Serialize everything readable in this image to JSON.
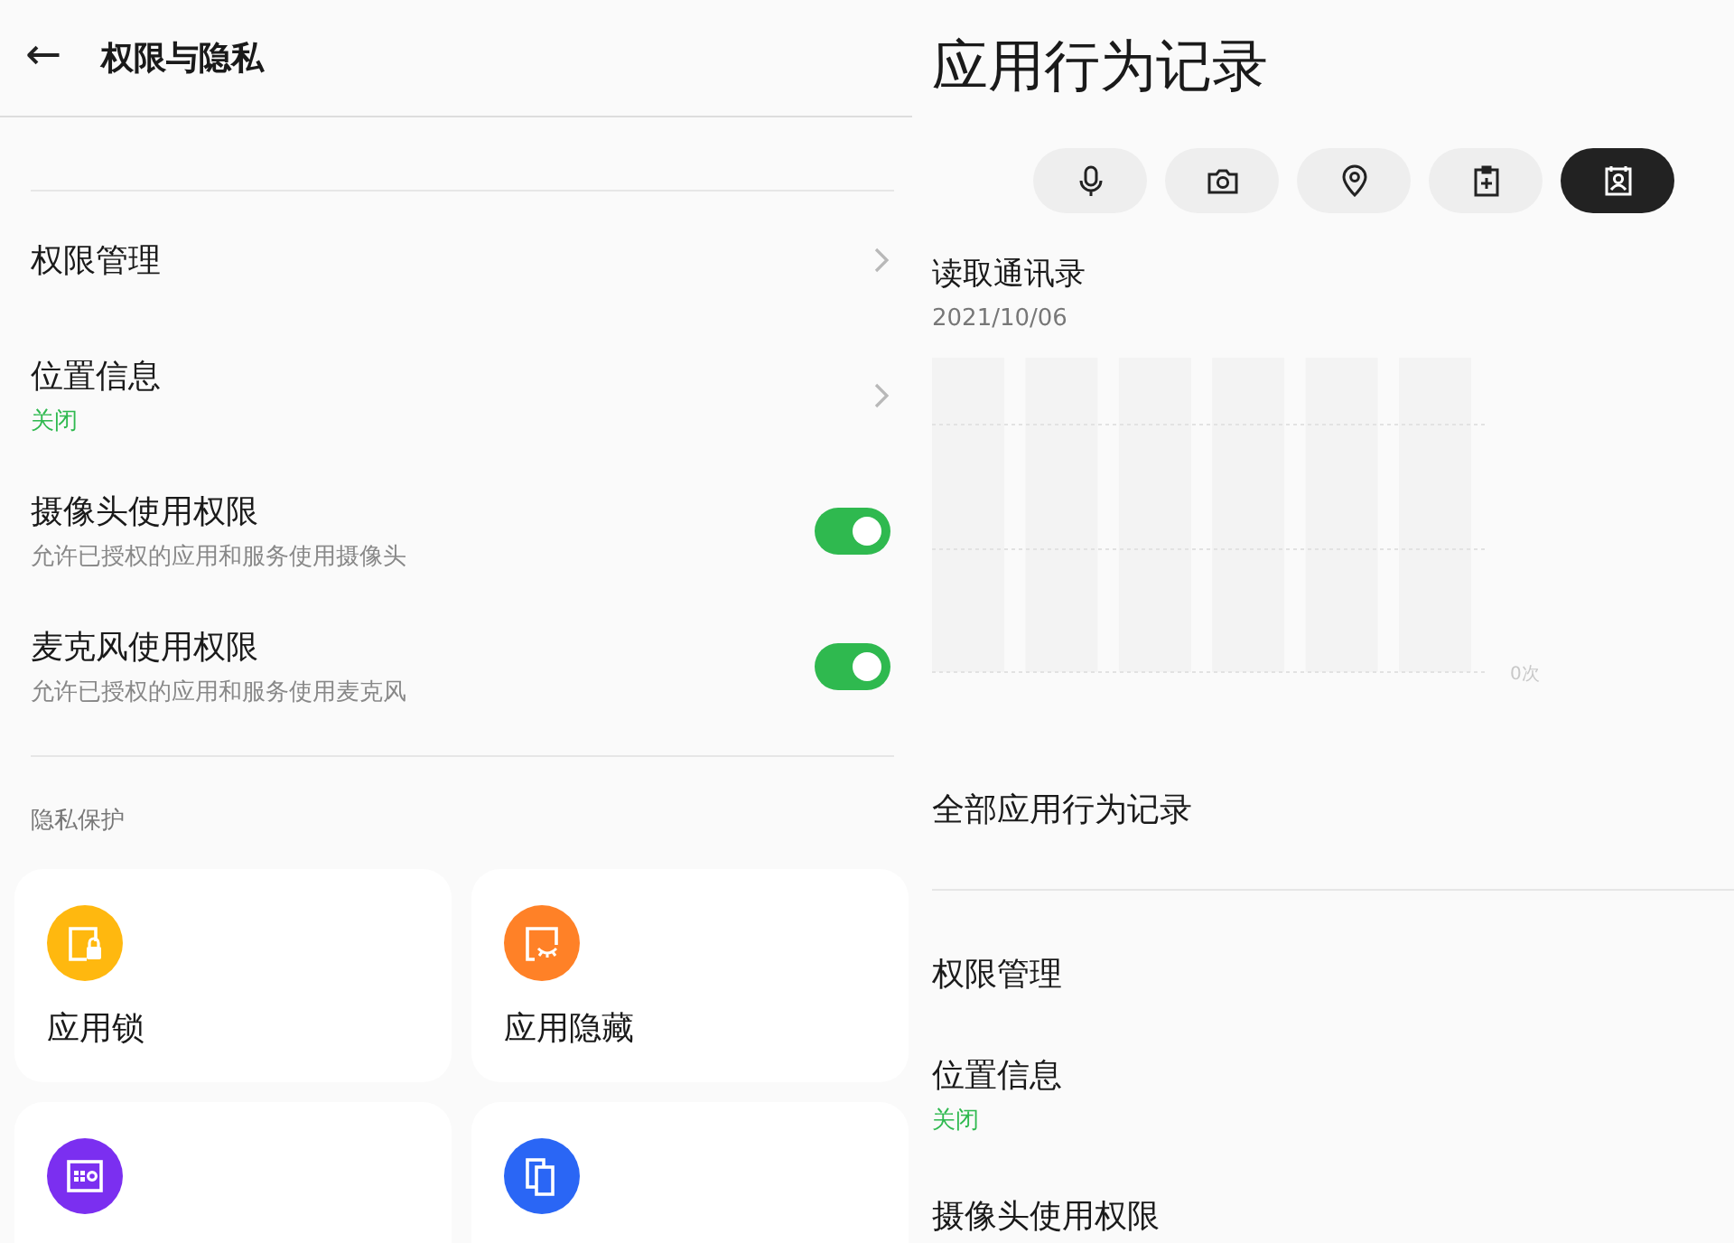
{
  "left": {
    "header": {
      "back": "←",
      "title": "权限与隐私"
    },
    "rows": [
      {
        "kind": "link",
        "title": "权限管理"
      },
      {
        "kind": "link",
        "title": "位置信息",
        "status": "关闭"
      },
      {
        "kind": "toggle",
        "title": "摄像头使用权限",
        "subtitle": "允许已授权的应用和服务使用摄像头",
        "on": true
      },
      {
        "kind": "toggle",
        "title": "麦克风使用权限",
        "subtitle": "允许已授权的应用和服务使用麦克风",
        "on": true
      }
    ],
    "section": "隐私保护",
    "cards": [
      {
        "kind": "lock",
        "label": "应用锁",
        "color": "#ffb80f"
      },
      {
        "kind": "hide",
        "label": "应用隐藏",
        "color": "#ff8127"
      },
      {
        "kind": "safe",
        "color": "#7b2ff0"
      },
      {
        "kind": "clone",
        "color": "#2a66f5"
      }
    ]
  },
  "right": {
    "title": "应用行为记录",
    "tabs": [
      {
        "kind": "mic",
        "selected": false
      },
      {
        "kind": "camera",
        "selected": false
      },
      {
        "kind": "location",
        "selected": false
      },
      {
        "kind": "clipboard",
        "selected": false
      },
      {
        "kind": "contacts",
        "selected": true
      }
    ],
    "record": {
      "title": "读取通讯录",
      "date": "2021/10/06",
      "axis_label": "0次"
    },
    "rows": [
      {
        "kind": "link",
        "title": "全部应用行为记录"
      },
      {
        "kind": "divider"
      },
      {
        "kind": "link",
        "title": "权限管理"
      },
      {
        "kind": "link",
        "title": "位置信息",
        "status": "关闭"
      },
      {
        "kind": "link",
        "title": "摄像头使用权限"
      }
    ]
  }
}
